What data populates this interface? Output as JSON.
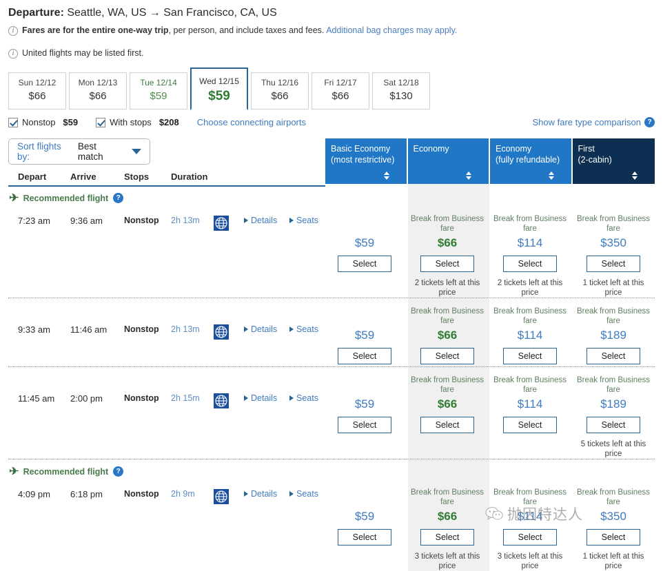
{
  "header": {
    "departure_label": "Departure:",
    "route": "Seattle, WA, US → San Francisco, CA, US",
    "note1_strong": "Fares are for the entire one-way trip",
    "note1_rest": ", per person, and include taxes and fees.",
    "note1_link": "Additional bag charges may apply.",
    "note2": "United flights may be listed first.",
    "info_icon": "info-icon"
  },
  "date_tabs": [
    {
      "day": "Sun 12/12",
      "price": "$66",
      "selected": false,
      "lowest": false
    },
    {
      "day": "Mon 12/13",
      "price": "$66",
      "selected": false,
      "lowest": false
    },
    {
      "day": "Tue 12/14",
      "price": "$59",
      "selected": false,
      "lowest": true
    },
    {
      "day": "Wed 12/15",
      "price": "$59",
      "selected": true,
      "lowest": false
    },
    {
      "day": "Thu 12/16",
      "price": "$66",
      "selected": false,
      "lowest": false
    },
    {
      "day": "Fri 12/17",
      "price": "$66",
      "selected": false,
      "lowest": false
    },
    {
      "day": "Sat 12/18",
      "price": "$130",
      "selected": false,
      "lowest": false
    }
  ],
  "filters": {
    "nonstop_label": "Nonstop",
    "nonstop_price": "$59",
    "nonstop_checked": true,
    "withstops_label": "With stops",
    "withstops_price": "$208",
    "withstops_checked": true,
    "connecting_link": "Choose connecting airports",
    "fare_comparison_link": "Show fare type comparison",
    "help_icon": "?"
  },
  "sort": {
    "label": "Sort flights by:",
    "value": "Best match",
    "caret_icon": "chevron-down-icon"
  },
  "table_headers": {
    "depart": "Depart",
    "arrive": "Arrive",
    "stops": "Stops",
    "duration": "Duration"
  },
  "fare_columns": [
    {
      "title": "Basic Economy",
      "subtitle": "(most restrictive)",
      "dark": false
    },
    {
      "title": "Economy",
      "subtitle": "",
      "dark": false
    },
    {
      "title": "Economy",
      "subtitle": "(fully refundable)",
      "dark": false
    },
    {
      "title": "First",
      "subtitle": "(2-cabin)",
      "dark": true
    }
  ],
  "labels": {
    "recommended": "Recommended flight",
    "select": "Select",
    "details": "Details",
    "seats": "Seats",
    "break_from_business": "Break from Business fare"
  },
  "flights": [
    {
      "recommended": true,
      "depart": "7:23 am",
      "arrive": "9:36 am",
      "stops": "Nonstop",
      "duration": "2h 13m",
      "airline_logo": "united-globe-icon",
      "fares": [
        {
          "break": false,
          "price": "$59",
          "green": false,
          "left": ""
        },
        {
          "break": true,
          "price": "$66",
          "green": true,
          "left": "2 tickets left at this price"
        },
        {
          "break": true,
          "price": "$114",
          "green": false,
          "left": "2 tickets left at this price"
        },
        {
          "break": true,
          "price": "$350",
          "green": false,
          "left": "1 ticket left at this price"
        }
      ]
    },
    {
      "recommended": false,
      "depart": "9:33 am",
      "arrive": "11:46 am",
      "stops": "Nonstop",
      "duration": "2h 13m",
      "airline_logo": "united-globe-icon",
      "fares": [
        {
          "break": false,
          "price": "$59",
          "green": false,
          "left": ""
        },
        {
          "break": true,
          "price": "$66",
          "green": true,
          "left": ""
        },
        {
          "break": true,
          "price": "$114",
          "green": false,
          "left": ""
        },
        {
          "break": true,
          "price": "$189",
          "green": false,
          "left": ""
        }
      ]
    },
    {
      "recommended": false,
      "depart": "11:45 am",
      "arrive": "2:00 pm",
      "stops": "Nonstop",
      "duration": "2h 15m",
      "airline_logo": "united-globe-icon",
      "fares": [
        {
          "break": false,
          "price": "$59",
          "green": false,
          "left": ""
        },
        {
          "break": true,
          "price": "$66",
          "green": true,
          "left": ""
        },
        {
          "break": true,
          "price": "$114",
          "green": false,
          "left": ""
        },
        {
          "break": true,
          "price": "$189",
          "green": false,
          "left": "5 tickets left at this price"
        }
      ]
    },
    {
      "recommended": true,
      "depart": "4:09 pm",
      "arrive": "6:18 pm",
      "stops": "Nonstop",
      "duration": "2h 9m",
      "airline_logo": "united-globe-icon",
      "fares": [
        {
          "break": false,
          "price": "$59",
          "green": false,
          "left": ""
        },
        {
          "break": true,
          "price": "$66",
          "green": true,
          "left": "3 tickets left at this price"
        },
        {
          "break": true,
          "price": "$114",
          "green": false,
          "left": "3 tickets left at this price"
        },
        {
          "break": true,
          "price": "$350",
          "green": false,
          "left": "1 ticket left at this price"
        }
      ]
    }
  ],
  "watermark": {
    "text": "抛因特达人"
  },
  "colors": {
    "header_blue": "#2077c6",
    "header_dark": "#0d2f52",
    "link_blue": "#3f7bbf",
    "green": "#2e7d32",
    "highlight_band": "#f0f0f0"
  }
}
